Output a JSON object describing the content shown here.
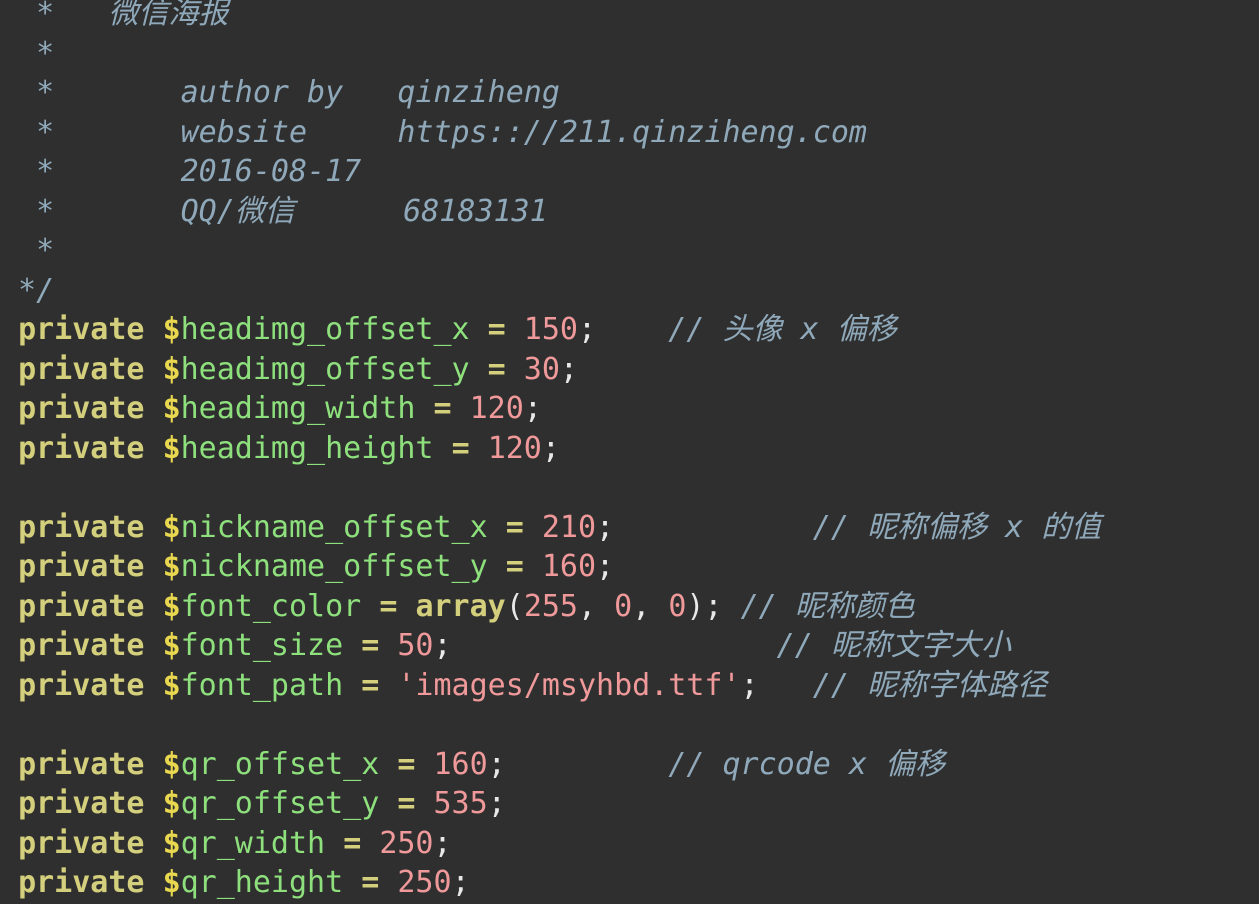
{
  "editor": {
    "language": "PHP",
    "background_color": "#2f2f2f",
    "font_size_px": 30,
    "line_height_px": 39.5,
    "theme_colors": {
      "comment": "#8fa9ba",
      "keyword": "#d4cf7c",
      "variable_sigil": "#e9d84f",
      "variable_name": "#8ee07d",
      "operator": "#d4cf7c",
      "number": "#f0999a",
      "string": "#f0999a",
      "punctuation": "#e8e8e8"
    }
  },
  "doc_comment": {
    "title_line": "  *   微信海报",
    "blank_star": "  *",
    "author_label": "author by",
    "author_value": "qinziheng",
    "website_label": "website",
    "website_value": "https:://211.qinziheng.com",
    "date_value": "2016-08-17",
    "contact_label": "QQ/微信",
    "contact_value": "68183131",
    "close_token": "*/"
  },
  "lines": [
    {
      "id": "comment-title",
      "type": "comment",
      "tokens": [
        {
          "cls": "comment",
          "text": "  *   微信海报"
        }
      ]
    },
    {
      "id": "comment-blank-1",
      "type": "comment",
      "tokens": [
        {
          "cls": "comment",
          "text": "  *"
        }
      ]
    },
    {
      "id": "comment-author",
      "type": "comment",
      "tokens": [
        {
          "cls": "comment",
          "text": "  *       author by   qinziheng"
        }
      ]
    },
    {
      "id": "comment-website",
      "type": "comment",
      "tokens": [
        {
          "cls": "comment",
          "text": "  *       website     https:://211.qinziheng.com"
        }
      ]
    },
    {
      "id": "comment-date",
      "type": "comment",
      "tokens": [
        {
          "cls": "comment",
          "text": "  *       2016-08-17"
        }
      ]
    },
    {
      "id": "comment-contact",
      "type": "comment",
      "tokens": [
        {
          "cls": "comment",
          "text": "  *       QQ/微信      68183131"
        }
      ]
    },
    {
      "id": "comment-blank-2",
      "type": "comment",
      "tokens": [
        {
          "cls": "comment",
          "text": "  *"
        }
      ]
    },
    {
      "id": "comment-close",
      "type": "comment",
      "tokens": [
        {
          "cls": "comment",
          "text": " */"
        }
      ]
    },
    {
      "id": "prop-headimg-offset-x",
      "type": "code",
      "tokens": [
        {
          "cls": "blank",
          "text": " "
        },
        {
          "cls": "keyword",
          "text": "private"
        },
        {
          "cls": "blank",
          "text": " "
        },
        {
          "cls": "dollar",
          "text": "$"
        },
        {
          "cls": "varname",
          "text": "headimg_offset_x"
        },
        {
          "cls": "blank",
          "text": " "
        },
        {
          "cls": "operator",
          "text": "="
        },
        {
          "cls": "blank",
          "text": " "
        },
        {
          "cls": "number",
          "text": "150"
        },
        {
          "cls": "punct",
          "text": ";"
        },
        {
          "cls": "blank",
          "text": "    "
        },
        {
          "cls": "comment",
          "text": "// 头像 x 偏移"
        }
      ]
    },
    {
      "id": "prop-headimg-offset-y",
      "type": "code",
      "tokens": [
        {
          "cls": "blank",
          "text": " "
        },
        {
          "cls": "keyword",
          "text": "private"
        },
        {
          "cls": "blank",
          "text": " "
        },
        {
          "cls": "dollar",
          "text": "$"
        },
        {
          "cls": "varname",
          "text": "headimg_offset_y"
        },
        {
          "cls": "blank",
          "text": " "
        },
        {
          "cls": "operator",
          "text": "="
        },
        {
          "cls": "blank",
          "text": " "
        },
        {
          "cls": "number",
          "text": "30"
        },
        {
          "cls": "punct",
          "text": ";"
        }
      ]
    },
    {
      "id": "prop-headimg-width",
      "type": "code",
      "tokens": [
        {
          "cls": "blank",
          "text": " "
        },
        {
          "cls": "keyword",
          "text": "private"
        },
        {
          "cls": "blank",
          "text": " "
        },
        {
          "cls": "dollar",
          "text": "$"
        },
        {
          "cls": "varname",
          "text": "headimg_width"
        },
        {
          "cls": "blank",
          "text": " "
        },
        {
          "cls": "operator",
          "text": "="
        },
        {
          "cls": "blank",
          "text": " "
        },
        {
          "cls": "number",
          "text": "120"
        },
        {
          "cls": "punct",
          "text": ";"
        }
      ]
    },
    {
      "id": "prop-headimg-height",
      "type": "code",
      "tokens": [
        {
          "cls": "blank",
          "text": " "
        },
        {
          "cls": "keyword",
          "text": "private"
        },
        {
          "cls": "blank",
          "text": " "
        },
        {
          "cls": "dollar",
          "text": "$"
        },
        {
          "cls": "varname",
          "text": "headimg_height"
        },
        {
          "cls": "blank",
          "text": " "
        },
        {
          "cls": "operator",
          "text": "="
        },
        {
          "cls": "blank",
          "text": " "
        },
        {
          "cls": "number",
          "text": "120"
        },
        {
          "cls": "punct",
          "text": ";"
        }
      ]
    },
    {
      "id": "blank-line-1",
      "type": "blank",
      "tokens": [
        {
          "cls": "blank",
          "text": " "
        }
      ]
    },
    {
      "id": "prop-nickname-offset-x",
      "type": "code",
      "tokens": [
        {
          "cls": "blank",
          "text": " "
        },
        {
          "cls": "keyword",
          "text": "private"
        },
        {
          "cls": "blank",
          "text": " "
        },
        {
          "cls": "dollar",
          "text": "$"
        },
        {
          "cls": "varname",
          "text": "nickname_offset_x"
        },
        {
          "cls": "blank",
          "text": " "
        },
        {
          "cls": "operator",
          "text": "="
        },
        {
          "cls": "blank",
          "text": " "
        },
        {
          "cls": "number",
          "text": "210"
        },
        {
          "cls": "punct",
          "text": ";"
        },
        {
          "cls": "blank",
          "text": "           "
        },
        {
          "cls": "comment",
          "text": "// 昵称偏移 x 的值"
        }
      ]
    },
    {
      "id": "prop-nickname-offset-y",
      "type": "code",
      "tokens": [
        {
          "cls": "blank",
          "text": " "
        },
        {
          "cls": "keyword",
          "text": "private"
        },
        {
          "cls": "blank",
          "text": " "
        },
        {
          "cls": "dollar",
          "text": "$"
        },
        {
          "cls": "varname",
          "text": "nickname_offset_y"
        },
        {
          "cls": "blank",
          "text": " "
        },
        {
          "cls": "operator",
          "text": "="
        },
        {
          "cls": "blank",
          "text": " "
        },
        {
          "cls": "number",
          "text": "160"
        },
        {
          "cls": "punct",
          "text": ";"
        }
      ]
    },
    {
      "id": "prop-font-color",
      "type": "code",
      "tokens": [
        {
          "cls": "blank",
          "text": " "
        },
        {
          "cls": "keyword",
          "text": "private"
        },
        {
          "cls": "blank",
          "text": " "
        },
        {
          "cls": "dollar",
          "text": "$"
        },
        {
          "cls": "varname",
          "text": "font_color"
        },
        {
          "cls": "blank",
          "text": " "
        },
        {
          "cls": "operator",
          "text": "="
        },
        {
          "cls": "blank",
          "text": " "
        },
        {
          "cls": "func",
          "text": "array"
        },
        {
          "cls": "punct",
          "text": "("
        },
        {
          "cls": "number",
          "text": "255"
        },
        {
          "cls": "punct",
          "text": ","
        },
        {
          "cls": "blank",
          "text": " "
        },
        {
          "cls": "number",
          "text": "0"
        },
        {
          "cls": "punct",
          "text": ","
        },
        {
          "cls": "blank",
          "text": " "
        },
        {
          "cls": "number",
          "text": "0"
        },
        {
          "cls": "punct",
          "text": ");"
        },
        {
          "cls": "blank",
          "text": " "
        },
        {
          "cls": "comment",
          "text": "// 昵称颜色"
        }
      ]
    },
    {
      "id": "prop-font-size",
      "type": "code",
      "tokens": [
        {
          "cls": "blank",
          "text": " "
        },
        {
          "cls": "keyword",
          "text": "private"
        },
        {
          "cls": "blank",
          "text": " "
        },
        {
          "cls": "dollar",
          "text": "$"
        },
        {
          "cls": "varname",
          "text": "font_size"
        },
        {
          "cls": "blank",
          "text": " "
        },
        {
          "cls": "operator",
          "text": "="
        },
        {
          "cls": "blank",
          "text": " "
        },
        {
          "cls": "number",
          "text": "50"
        },
        {
          "cls": "punct",
          "text": ";"
        },
        {
          "cls": "blank",
          "text": "                  "
        },
        {
          "cls": "comment",
          "text": "// 昵称文字大小"
        }
      ]
    },
    {
      "id": "prop-font-path",
      "type": "code",
      "tokens": [
        {
          "cls": "blank",
          "text": " "
        },
        {
          "cls": "keyword",
          "text": "private"
        },
        {
          "cls": "blank",
          "text": " "
        },
        {
          "cls": "dollar",
          "text": "$"
        },
        {
          "cls": "varname",
          "text": "font_path"
        },
        {
          "cls": "blank",
          "text": " "
        },
        {
          "cls": "operator",
          "text": "="
        },
        {
          "cls": "blank",
          "text": " "
        },
        {
          "cls": "string",
          "text": "'images/msyhbd.ttf'"
        },
        {
          "cls": "punct",
          "text": ";"
        },
        {
          "cls": "blank",
          "text": "   "
        },
        {
          "cls": "comment",
          "text": "// 昵称字体路径"
        }
      ]
    },
    {
      "id": "blank-line-2",
      "type": "blank",
      "tokens": [
        {
          "cls": "blank",
          "text": " "
        }
      ]
    },
    {
      "id": "prop-qr-offset-x",
      "type": "code",
      "tokens": [
        {
          "cls": "blank",
          "text": " "
        },
        {
          "cls": "keyword",
          "text": "private"
        },
        {
          "cls": "blank",
          "text": " "
        },
        {
          "cls": "dollar",
          "text": "$"
        },
        {
          "cls": "varname",
          "text": "qr_offset_x"
        },
        {
          "cls": "blank",
          "text": " "
        },
        {
          "cls": "operator",
          "text": "="
        },
        {
          "cls": "blank",
          "text": " "
        },
        {
          "cls": "number",
          "text": "160"
        },
        {
          "cls": "punct",
          "text": ";"
        },
        {
          "cls": "blank",
          "text": "         "
        },
        {
          "cls": "comment",
          "text": "// qrcode x 偏移"
        }
      ]
    },
    {
      "id": "prop-qr-offset-y",
      "type": "code",
      "tokens": [
        {
          "cls": "blank",
          "text": " "
        },
        {
          "cls": "keyword",
          "text": "private"
        },
        {
          "cls": "blank",
          "text": " "
        },
        {
          "cls": "dollar",
          "text": "$"
        },
        {
          "cls": "varname",
          "text": "qr_offset_y"
        },
        {
          "cls": "blank",
          "text": " "
        },
        {
          "cls": "operator",
          "text": "="
        },
        {
          "cls": "blank",
          "text": " "
        },
        {
          "cls": "number",
          "text": "535"
        },
        {
          "cls": "punct",
          "text": ";"
        }
      ]
    },
    {
      "id": "prop-qr-width",
      "type": "code",
      "tokens": [
        {
          "cls": "blank",
          "text": " "
        },
        {
          "cls": "keyword",
          "text": "private"
        },
        {
          "cls": "blank",
          "text": " "
        },
        {
          "cls": "dollar",
          "text": "$"
        },
        {
          "cls": "varname",
          "text": "qr_width"
        },
        {
          "cls": "blank",
          "text": " "
        },
        {
          "cls": "operator",
          "text": "="
        },
        {
          "cls": "blank",
          "text": " "
        },
        {
          "cls": "number",
          "text": "250"
        },
        {
          "cls": "punct",
          "text": ";"
        }
      ]
    },
    {
      "id": "prop-qr-height",
      "type": "code",
      "tokens": [
        {
          "cls": "blank",
          "text": " "
        },
        {
          "cls": "keyword",
          "text": "private"
        },
        {
          "cls": "blank",
          "text": " "
        },
        {
          "cls": "dollar",
          "text": "$"
        },
        {
          "cls": "varname",
          "text": "qr_height"
        },
        {
          "cls": "blank",
          "text": " "
        },
        {
          "cls": "operator",
          "text": "="
        },
        {
          "cls": "blank",
          "text": " "
        },
        {
          "cls": "number",
          "text": "250"
        },
        {
          "cls": "punct",
          "text": ";"
        }
      ]
    }
  ]
}
